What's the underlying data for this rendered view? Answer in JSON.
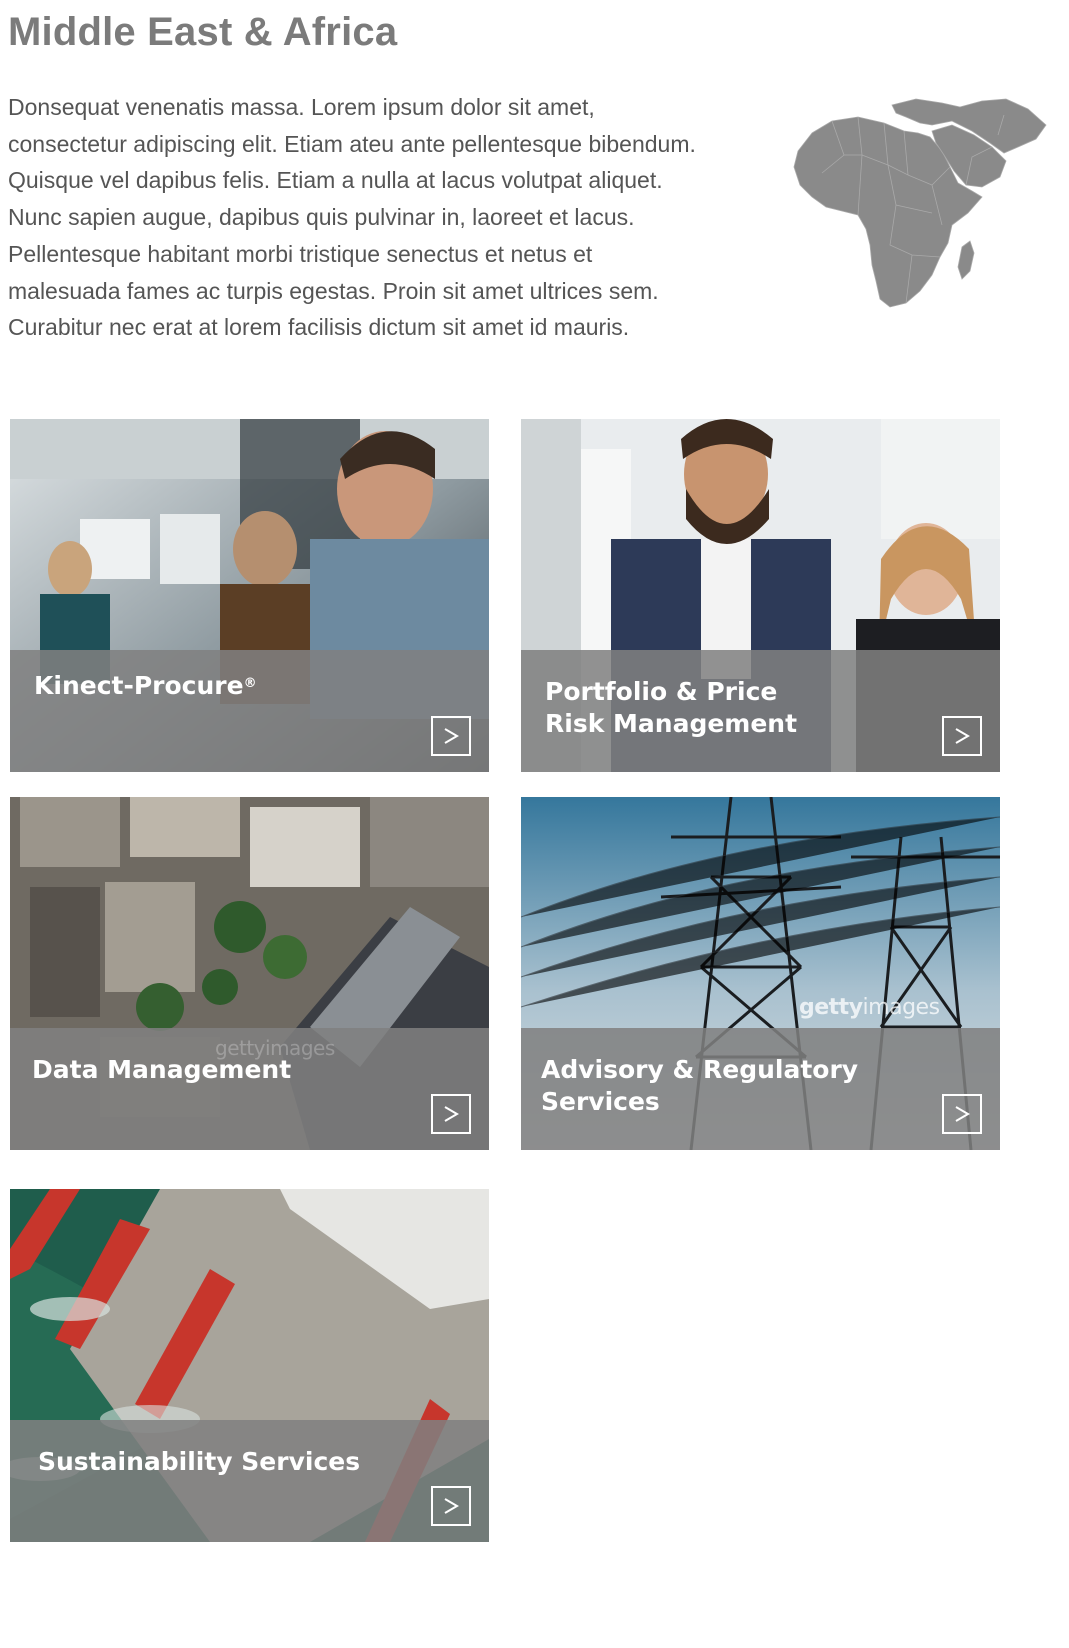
{
  "page": {
    "title": "Middle East & Africa",
    "intro_lines": [
      "Donsequat venenatis massa. Lorem ipsum dolor sit amet,",
      "consectetur adipiscing elit. Etiam ateu ante pellentesque bibendum.",
      "Quisque vel dapibus felis. Etiam a nulla at lacus volutpat aliquet.",
      "Nunc sapien augue, dapibus quis pulvinar in, laoreet et lacus.",
      "Pellentesque habitant morbi tristique senectus et netus et",
      "malesuada fames ac turpis egestas. Proin sit amet ultrices sem.",
      "Curabitur nec erat at lorem facilisis dictum sit amet id mauris."
    ],
    "map_icon": "middle-east-africa-map-icon"
  },
  "tiles": [
    {
      "label_line1": "Kinect-Procure",
      "label_sup": "®",
      "label_line2": "",
      "arrow": ">",
      "photo": "office-meeting-photo"
    },
    {
      "label_line1": "Portfolio & Price",
      "label_sup": "",
      "label_line2": "Risk Management",
      "arrow": ">",
      "photo": "business-people-photo"
    },
    {
      "label_line1": "Data Management",
      "label_sup": "",
      "label_line2": "",
      "arrow": ">",
      "photo": "aerial-city-photo",
      "watermark": "gettyimages"
    },
    {
      "label_line1": "Advisory & Regulatory",
      "label_sup": "",
      "label_line2": "Services",
      "arrow": ">",
      "photo": "power-lines-photo",
      "watermark_bold": "getty",
      "watermark_rest": "images"
    },
    {
      "label_line1": "Sustainability Services",
      "label_sup": "",
      "label_line2": "",
      "arrow": ">",
      "photo": "bridge-water-photo"
    }
  ],
  "colors": {
    "title": "#7b7b7b",
    "body_text": "#555555",
    "overlay": "#808080",
    "map": "#8a8a8a"
  }
}
